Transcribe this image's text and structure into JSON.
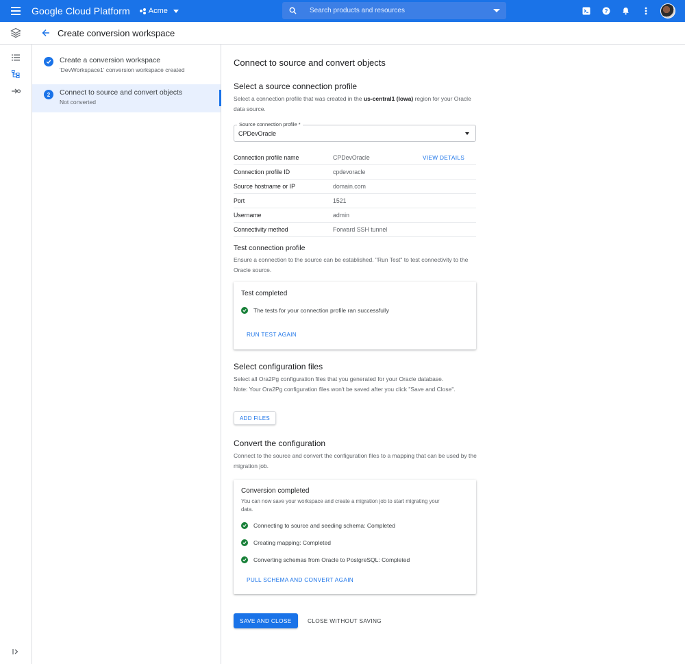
{
  "topbar": {
    "brand": "Google Cloud Platform",
    "project": "Acme",
    "search_placeholder": "Search products and resources",
    "icons": [
      "menu-icon",
      "search-icon",
      "cloud-shell-icon",
      "help-icon",
      "notifications-icon",
      "more-vert-icon",
      "avatar"
    ]
  },
  "subheader": {
    "title": "Create conversion workspace"
  },
  "rail": {
    "icons": [
      "list-icon",
      "tree-icon",
      "migrate-icon",
      "expand-rail-icon"
    ]
  },
  "steps": [
    {
      "number": "1",
      "title": "Create a conversion workspace",
      "subtitle": "'DevWorkspace1' conversion workspace created",
      "status": "completed"
    },
    {
      "number": "2",
      "title": "Connect to source and convert objects",
      "subtitle": "Not converted",
      "status": "active"
    }
  ],
  "main": {
    "heading": "Connect to source and convert objects",
    "profile_section": {
      "title": "Select a source connection profile",
      "desc_pre": "Select a connection profile that was created in the ",
      "desc_region": "us-central1 (Iowa)",
      "desc_post": " region for your Oracle data source.",
      "field_label": "Source connection profile *",
      "field_value": "CPDevOracle"
    },
    "details": [
      {
        "key": "Connection profile name",
        "value": "CPDevOracle",
        "link": "VIEW DETAILS"
      },
      {
        "key": "Connection profile ID",
        "value": "cpdevoracle"
      },
      {
        "key": "Source hostname or IP",
        "value": "domain.com"
      },
      {
        "key": "Port",
        "value": "1521"
      },
      {
        "key": "Username",
        "value": "admin"
      },
      {
        "key": "Connectivity method",
        "value": "Forward SSH tunnel"
      }
    ],
    "test": {
      "title": "Test connection profile",
      "desc": "Ensure a connection to the source can be established. \"Run Test\" to test connectivity to the Oracle source.",
      "card_title": "Test completed",
      "result": "The tests for your connection profile ran successfully",
      "button": "RUN TEST AGAIN"
    },
    "config": {
      "title": "Select configuration files",
      "desc_line1": "Select all Ora2Pg configuration files that you generated for your Oracle database.",
      "desc_line2": "Note: Your Ora2Pg configuration files won't be saved after you click \"Save and Close\".",
      "button": "ADD FILES"
    },
    "convert": {
      "title": "Convert the configuration",
      "desc": "Connect to the source and convert the configuration files to a mapping that can be used by the migration job.",
      "card_title": "Conversion completed",
      "card_desc": "You can now save your workspace and create a migration job to start migrating your data.",
      "results": [
        "Connecting to source and seeding schema: Completed",
        "Creating mapping: Completed",
        "Converting schemas from Oracle to PostgreSQL: Completed"
      ],
      "button": "PULL SCHEMA AND CONVERT AGAIN"
    },
    "actions": {
      "save": "SAVE AND CLOSE",
      "close": "CLOSE WITHOUT SAVING"
    }
  },
  "colors": {
    "primary": "#1a73e8",
    "success": "#188038",
    "divider": "#dadce0"
  }
}
